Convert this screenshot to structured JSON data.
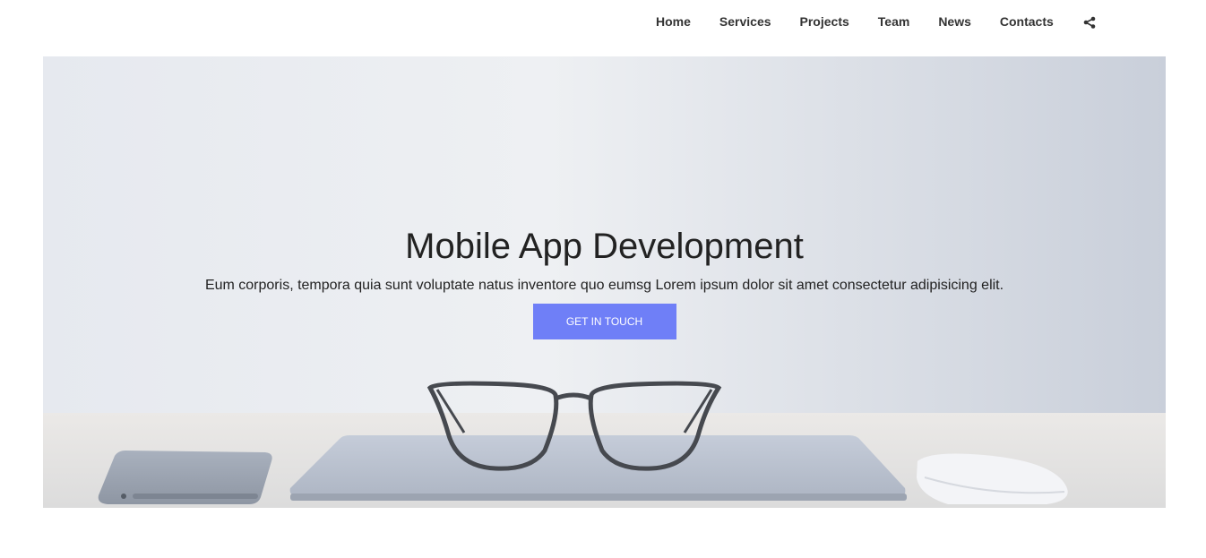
{
  "nav": {
    "items": [
      {
        "label": "Home"
      },
      {
        "label": "Services"
      },
      {
        "label": "Projects"
      },
      {
        "label": "Team"
      },
      {
        "label": "News"
      },
      {
        "label": "Contacts"
      }
    ],
    "share_icon": "share-icon"
  },
  "hero": {
    "title": "Mobile App Development",
    "subtitle": "Eum corporis, tempora quia sunt voluptate natus inventore quo eumsg Lorem ipsum dolor sit amet consectetur adipisicing elit.",
    "cta_label": "GET IN TOUCH",
    "background_image": "desk-with-glasses-laptop-phone-mouse"
  },
  "colors": {
    "accent": "#6f7ff7",
    "nav_text": "#333333",
    "hero_text": "#222222"
  }
}
